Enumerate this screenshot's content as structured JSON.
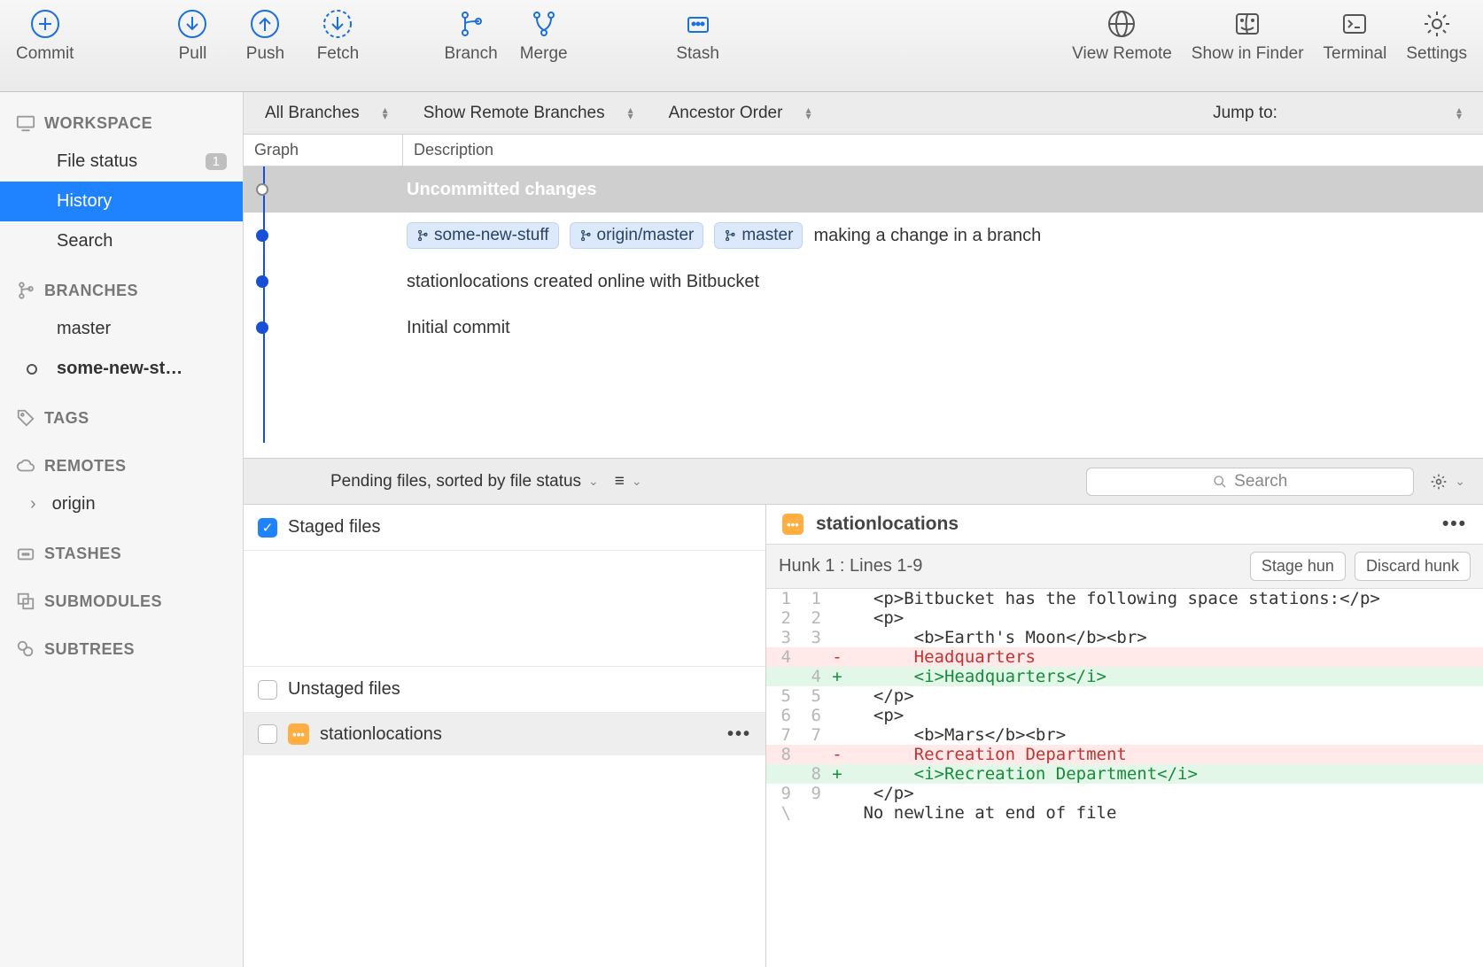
{
  "toolbar": {
    "left": [
      {
        "id": "commit",
        "label": "Commit"
      },
      {
        "id": "pull",
        "label": "Pull"
      },
      {
        "id": "push",
        "label": "Push"
      },
      {
        "id": "fetch",
        "label": "Fetch"
      }
    ],
    "mid": [
      {
        "id": "branch",
        "label": "Branch"
      },
      {
        "id": "merge",
        "label": "Merge"
      },
      {
        "id": "stash",
        "label": "Stash"
      }
    ],
    "right": [
      {
        "id": "view-remote",
        "label": "View Remote"
      },
      {
        "id": "show-finder",
        "label": "Show in Finder"
      },
      {
        "id": "terminal",
        "label": "Terminal"
      },
      {
        "id": "settings",
        "label": "Settings"
      }
    ]
  },
  "sidebar": {
    "workspace": {
      "header": "WORKSPACE",
      "items": [
        {
          "label": "File status",
          "badge": "1"
        },
        {
          "label": "History",
          "active": true
        },
        {
          "label": "Search"
        }
      ]
    },
    "branches": {
      "header": "BRANCHES",
      "items": [
        {
          "label": "master"
        },
        {
          "label": "some-new-st…",
          "current": true
        }
      ]
    },
    "tags": {
      "header": "TAGS"
    },
    "remotes": {
      "header": "REMOTES",
      "items": [
        {
          "label": "origin",
          "expandable": true
        }
      ]
    },
    "stashes": {
      "header": "STASHES"
    },
    "submodules": {
      "header": "SUBMODULES"
    },
    "subtrees": {
      "header": "SUBTREES"
    }
  },
  "filter": {
    "branches": "All Branches",
    "show_remote": "Show Remote Branches",
    "order": "Ancestor Order",
    "jump": "Jump to:"
  },
  "columns": {
    "graph": "Graph",
    "desc": "Description"
  },
  "commits": [
    {
      "type": "uncommitted",
      "desc": "Uncommitted changes"
    },
    {
      "type": "commit",
      "pills": [
        "some-new-stuff",
        "origin/master",
        "master"
      ],
      "desc": "making a change in a branch"
    },
    {
      "type": "commit",
      "desc": "stationlocations created online with Bitbucket"
    },
    {
      "type": "commit",
      "desc": "Initial commit"
    }
  ],
  "pending": {
    "label": "Pending files, sorted by file status",
    "search_placeholder": "Search"
  },
  "files": {
    "staged_header": "Staged files",
    "unstaged_header": "Unstaged files",
    "unstaged": [
      {
        "name": "stationlocations"
      }
    ]
  },
  "diff": {
    "filename": "stationlocations",
    "hunk": "Hunk 1 : Lines 1-9",
    "stage_btn": "Stage hun",
    "discard_btn": "Discard hunk",
    "lines": [
      {
        "ol": "1",
        "nl": "1",
        "t": " ",
        "c": "  <p>Bitbucket has the following space stations:</p>"
      },
      {
        "ol": "2",
        "nl": "2",
        "t": " ",
        "c": "  <p>"
      },
      {
        "ol": "3",
        "nl": "3",
        "t": " ",
        "c": "      <b>Earth's Moon</b><br>"
      },
      {
        "ol": "4",
        "nl": "",
        "t": "-",
        "c": "      Headquarters"
      },
      {
        "ol": "",
        "nl": "4",
        "t": "+",
        "c": "      <i>Headquarters</i>"
      },
      {
        "ol": "5",
        "nl": "5",
        "t": " ",
        "c": "  </p>"
      },
      {
        "ol": "6",
        "nl": "6",
        "t": " ",
        "c": "  <p>"
      },
      {
        "ol": "7",
        "nl": "7",
        "t": " ",
        "c": "      <b>Mars</b><br>"
      },
      {
        "ol": "8",
        "nl": "",
        "t": "-",
        "c": "      Recreation Department"
      },
      {
        "ol": "",
        "nl": "8",
        "t": "+",
        "c": "      <i>Recreation Department</i>"
      },
      {
        "ol": "9",
        "nl": "9",
        "t": " ",
        "c": "  </p>"
      },
      {
        "ol": "\\",
        "nl": "",
        "t": " ",
        "c": " No newline at end of file"
      }
    ]
  }
}
